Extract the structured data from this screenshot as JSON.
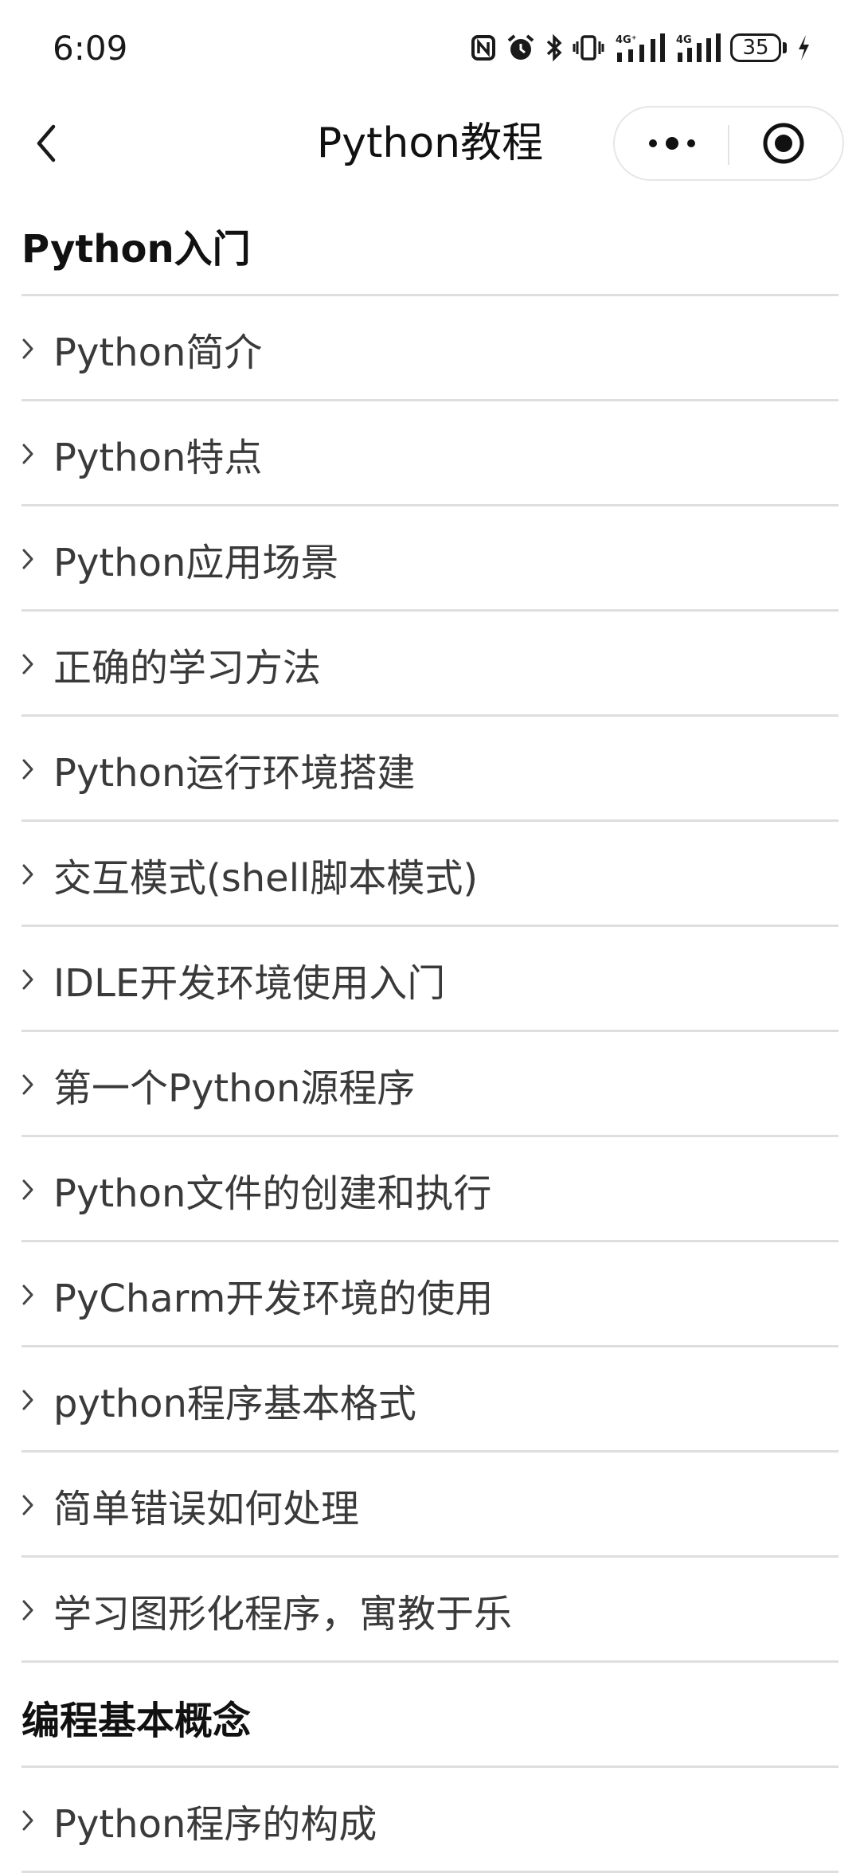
{
  "status_bar": {
    "time": "6:09",
    "battery": "35",
    "icons": [
      "nfc-icon",
      "alarm-icon",
      "bluetooth-icon",
      "vibrate-icon",
      "signal-4g-icon",
      "signal-4g-icon",
      "battery-icon",
      "charging-icon"
    ]
  },
  "nav": {
    "title": "Python教程",
    "back_icon": "chevron-left-icon",
    "more_icon": "more-dots-icon",
    "close_icon": "target-close-icon"
  },
  "sections": [
    {
      "title": "Python入门",
      "items": [
        "Python简介",
        "Python特点",
        "Python应用场景",
        "正确的学习方法",
        "Python运行环境搭建",
        "交互模式(shell脚本模式)",
        "IDLE开发环境使用入门",
        "第一个Python源程序",
        "Python文件的创建和执行",
        "PyCharm开发环境的使用",
        "python程序基本格式",
        "简单错误如何处理",
        "学习图形化程序，寓教于乐"
      ]
    },
    {
      "title": "编程基本概念",
      "items": [
        "Python程序的构成"
      ]
    }
  ],
  "colors": {
    "divider": "#dedede",
    "text": "#3a3a3a",
    "heading": "#111111"
  }
}
